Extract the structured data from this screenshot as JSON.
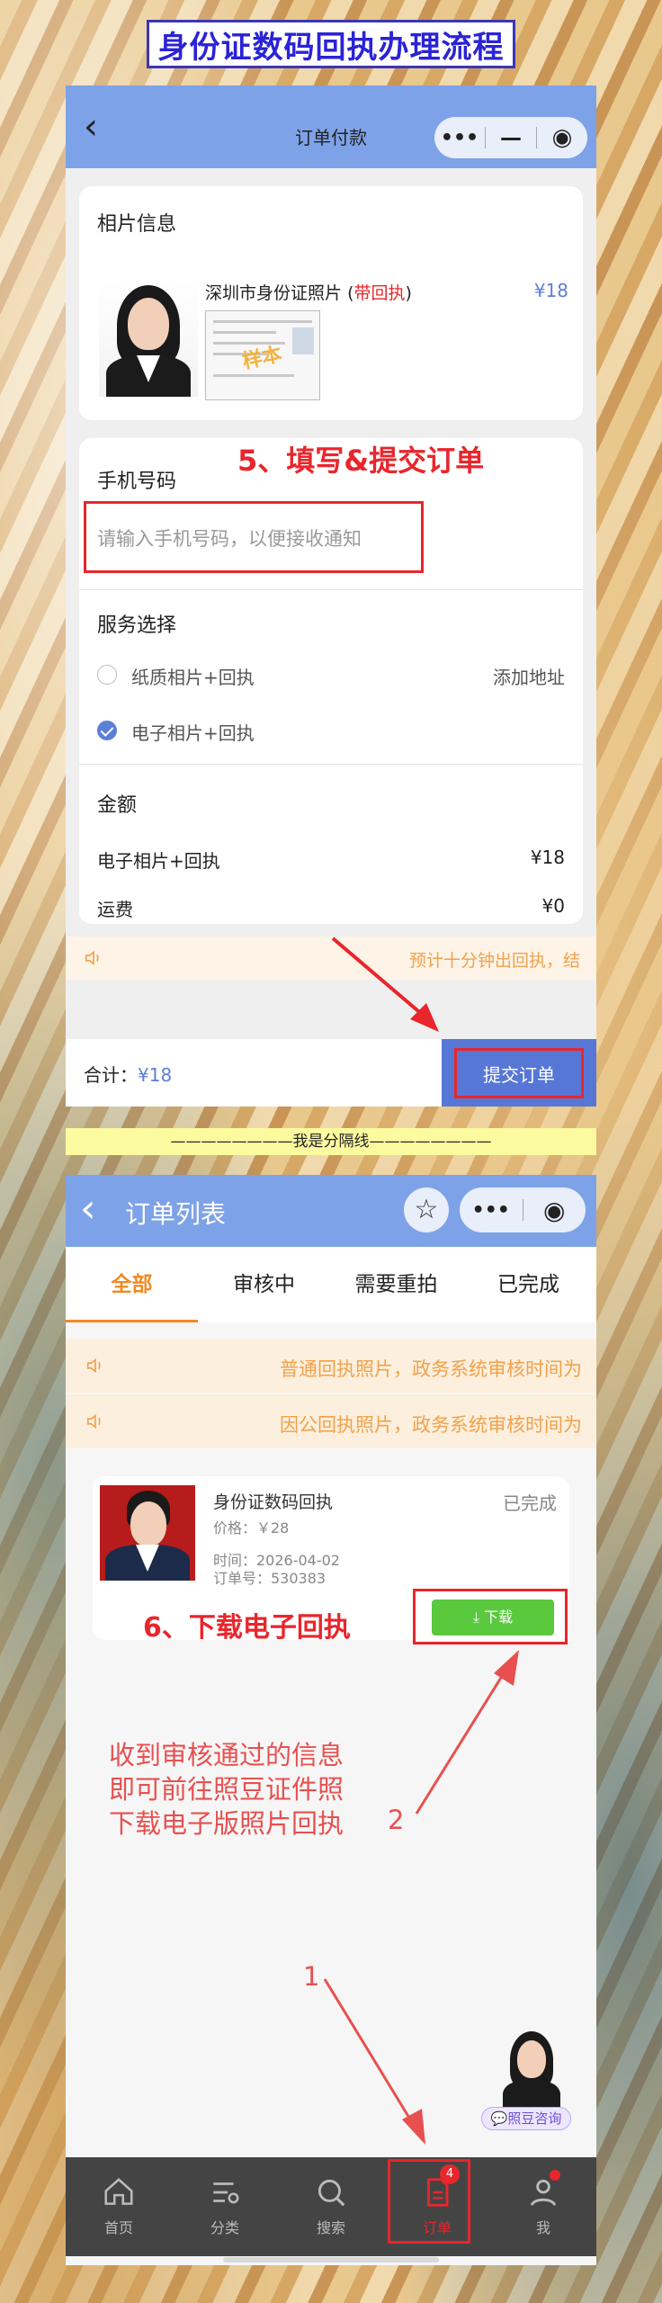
{
  "banner": {
    "title": "身份证数码回执办理流程"
  },
  "order_pay": {
    "nav_title": "订单付款",
    "photo_section": {
      "title": "相片信息",
      "product_name": "深圳市身份证照片",
      "product_tag_open": "(",
      "product_tag": "带回执",
      "product_tag_close": ")",
      "price": "¥18",
      "stamp": "样本"
    },
    "step5_label": "5、填写&提交订单",
    "phone": {
      "title": "手机号码",
      "placeholder": "请输入手机号码，以便接收通知"
    },
    "service": {
      "title": "服务选择",
      "option1": "纸质相片+回执",
      "add_address": "添加地址",
      "option2": "电子相片+回执",
      "selected": "option2"
    },
    "amount": {
      "title": "金额",
      "item_label": "电子相片+回执",
      "item_value": "¥18",
      "shipping_label": "运费",
      "shipping_value": "¥0"
    },
    "notice": "预计十分钟出回执，结",
    "total_label": "合计：",
    "total_value": "¥18",
    "submit_label": "提交订单"
  },
  "separator": {
    "text": "————————我是分隔线————————"
  },
  "order_list": {
    "nav_title": "订单列表",
    "tabs": [
      "全部",
      "审核中",
      "需要重拍",
      "已完成"
    ],
    "active_tab": 0,
    "notices": [
      "普通回执照片，政务系统审核时间为",
      "因公回执照片，政务系统审核时间为"
    ],
    "order": {
      "title": "身份证数码回执",
      "status": "已完成",
      "price": "价格：￥28",
      "time": "时间：2026-04-02",
      "order_no": "订单号：530383",
      "download_label": "下载"
    },
    "step6_label": "6、下载电子回执",
    "instruction_lines": [
      "收到审核通过的信息",
      "即可前往照豆证件照",
      "下载电子版照片回执"
    ],
    "step_numbers": [
      "1",
      "2"
    ],
    "consult_label": "照豆咨询",
    "tabbar": {
      "items": [
        "首页",
        "分类",
        "搜索",
        "订单",
        "我"
      ],
      "active": 3,
      "order_badge": "4"
    }
  },
  "colors": {
    "nav_blue": "#7ea2e8",
    "accent_orange": "#f08a24",
    "annotation_red": "#e8262c",
    "submit_blue": "#5677d6",
    "download_green": "#5ac93e"
  }
}
